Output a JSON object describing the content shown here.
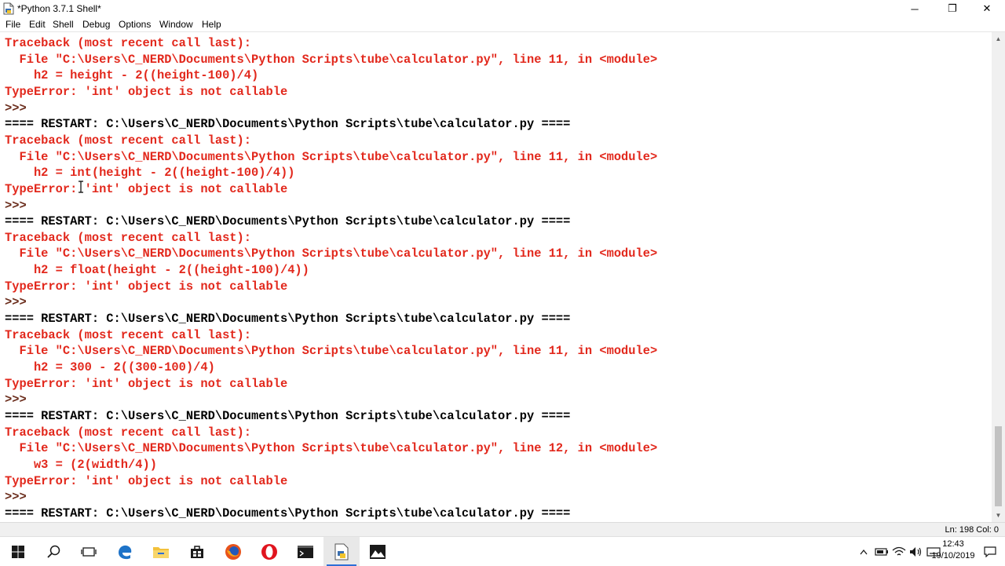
{
  "window": {
    "title": "*Python 3.7.1 Shell*",
    "minimize": "─",
    "restore": "❐",
    "close": "✕"
  },
  "menu": [
    "File",
    "Edit",
    "Shell",
    "Debug",
    "Options",
    "Window",
    "Help"
  ],
  "shell_lines": [
    {
      "kind": "err",
      "text": "Traceback (most recent call last):"
    },
    {
      "kind": "err",
      "text": "  File \"C:\\Users\\C_NERD\\Documents\\Python Scripts\\tube\\calculator.py\", line 11, in <module>"
    },
    {
      "kind": "err",
      "text": "    h2 = height - 2((height-100)/4)"
    },
    {
      "kind": "err",
      "text": "TypeError: 'int' object is not callable"
    },
    {
      "kind": "prompt",
      "text": ">>>"
    },
    {
      "kind": "restart",
      "text": "==== RESTART: C:\\Users\\C_NERD\\Documents\\Python Scripts\\tube\\calculator.py ===="
    },
    {
      "kind": "err",
      "text": "Traceback (most recent call last):"
    },
    {
      "kind": "err",
      "text": "  File \"C:\\Users\\C_NERD\\Documents\\Python Scripts\\tube\\calculator.py\", line 11, in <module>"
    },
    {
      "kind": "err",
      "text": "    h2 = int(height - 2((height-100)/4))"
    },
    {
      "kind": "err",
      "text": "TypeError: 'int' object is not callable"
    },
    {
      "kind": "prompt",
      "text": ">>>"
    },
    {
      "kind": "restart",
      "text": "==== RESTART: C:\\Users\\C_NERD\\Documents\\Python Scripts\\tube\\calculator.py ===="
    },
    {
      "kind": "err",
      "text": "Traceback (most recent call last):"
    },
    {
      "kind": "err",
      "text": "  File \"C:\\Users\\C_NERD\\Documents\\Python Scripts\\tube\\calculator.py\", line 11, in <module>"
    },
    {
      "kind": "err",
      "text": "    h2 = float(height - 2((height-100)/4))"
    },
    {
      "kind": "err",
      "text": "TypeError: 'int' object is not callable"
    },
    {
      "kind": "prompt",
      "text": ">>>"
    },
    {
      "kind": "restart",
      "text": "==== RESTART: C:\\Users\\C_NERD\\Documents\\Python Scripts\\tube\\calculator.py ===="
    },
    {
      "kind": "err",
      "text": "Traceback (most recent call last):"
    },
    {
      "kind": "err",
      "text": "  File \"C:\\Users\\C_NERD\\Documents\\Python Scripts\\tube\\calculator.py\", line 11, in <module>"
    },
    {
      "kind": "err",
      "text": "    h2 = 300 - 2((300-100)/4)"
    },
    {
      "kind": "err",
      "text": "TypeError: 'int' object is not callable"
    },
    {
      "kind": "prompt",
      "text": ">>>"
    },
    {
      "kind": "restart",
      "text": "==== RESTART: C:\\Users\\C_NERD\\Documents\\Python Scripts\\tube\\calculator.py ===="
    },
    {
      "kind": "err",
      "text": "Traceback (most recent call last):"
    },
    {
      "kind": "err",
      "text": "  File \"C:\\Users\\C_NERD\\Documents\\Python Scripts\\tube\\calculator.py\", line 12, in <module>"
    },
    {
      "kind": "err",
      "text": "    w3 = (2(width/4))"
    },
    {
      "kind": "err",
      "text": "TypeError: 'int' object is not callable"
    },
    {
      "kind": "prompt",
      "text": ">>>"
    },
    {
      "kind": "restart",
      "text": "==== RESTART: C:\\Users\\C_NERD\\Documents\\Python Scripts\\tube\\calculator.py ===="
    }
  ],
  "status": {
    "position": "Ln: 198   Col: 0"
  },
  "taskbar": {
    "icons": [
      "windows-start-icon",
      "search-icon",
      "task-view-icon",
      "edge-icon",
      "file-explorer-icon",
      "store-icon",
      "firefox-icon",
      "opera-icon",
      "terminal-icon",
      "idle-python-icon",
      "photos-icon"
    ],
    "active_icon": "idle-python-icon"
  },
  "clock": {
    "time": "12:43",
    "date": "19/10/2019"
  },
  "colors": {
    "error": "#e2281c",
    "restart": "#000000",
    "prompt": "#6b2d1c",
    "taskbar_accent": "#2e6fd6"
  }
}
